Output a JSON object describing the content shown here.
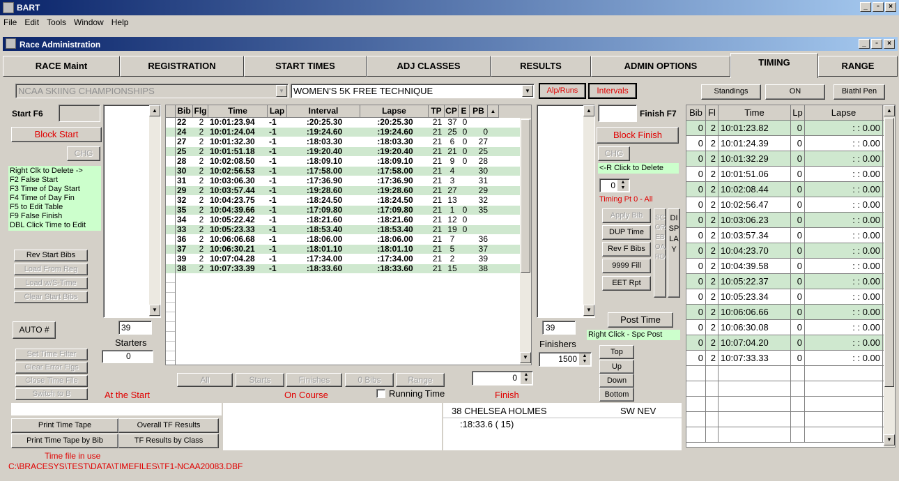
{
  "app": {
    "title": "BART",
    "child_title": "Race Administration"
  },
  "menu": [
    "File",
    "Edit",
    "Tools",
    "Window",
    "Help"
  ],
  "tabs": [
    "RACE Maint",
    "REGISTRATION",
    "START TIMES",
    "ADJ CLASSES",
    "RESULTS",
    "ADMIN OPTIONS",
    "TIMING",
    "RANGE"
  ],
  "active_tab": "TIMING",
  "event": {
    "championship": "NCAA SKIING CHAMPIONSHIPS",
    "race": "WOMEN'S 5K FREE TECHNIQUE"
  },
  "mode_buttons": {
    "alp_runs": "Alp/Runs",
    "intervals": "Intervals"
  },
  "top_right_buttons": {
    "standings": "Standings",
    "on": "ON",
    "biathl": "Biathl Pen"
  },
  "start": {
    "label": "Start F6",
    "block_start": "Block Start",
    "chg": "CHG",
    "help": [
      "Right Clk to Delete ->",
      "F2 False Start",
      "F3 Time of Day Start",
      "F4 Time of Day Fin",
      "F5 to Edit Table",
      "F9 False Finish",
      "DBL Click Time to Edit"
    ],
    "buttons": [
      "Rev Start Bibs",
      "Load From Reg",
      "Load w/S-Time",
      "Clear Start Bibs"
    ],
    "auto": "AUTO #",
    "starters_count": "39",
    "starters_label": "Starters",
    "filter_value": "0",
    "lower_buttons": [
      "Set Time Filter",
      "Clear Error Flgs",
      "Close Time File",
      "Switch to B"
    ],
    "status": "At the Start"
  },
  "main_table": {
    "headers": [
      "Bib",
      "Flg",
      "Time",
      "Lap",
      "Interval",
      "Lapse",
      "TP",
      "CP",
      "E",
      "PB"
    ],
    "rows": [
      [
        "22",
        "2",
        "10:01:23.94",
        "-1",
        ":20:25.30",
        ":20:25.30",
        "21",
        "37",
        "0",
        ""
      ],
      [
        "24",
        "2",
        "10:01:24.04",
        "-1",
        ":19:24.60",
        ":19:24.60",
        "21",
        "25",
        "0",
        "0"
      ],
      [
        "27",
        "2",
        "10:01:32.30",
        "-1",
        ":18:03.30",
        ":18:03.30",
        "21",
        "6",
        "0",
        "27"
      ],
      [
        "25",
        "2",
        "10:01:51.18",
        "-1",
        ":19:20.40",
        ":19:20.40",
        "21",
        "21",
        "0",
        "25"
      ],
      [
        "28",
        "2",
        "10:02:08.50",
        "-1",
        ":18:09.10",
        ":18:09.10",
        "21",
        "9",
        "0",
        "28"
      ],
      [
        "30",
        "2",
        "10:02:56.53",
        "-1",
        ":17:58.00",
        ":17:58.00",
        "21",
        "4",
        "",
        "30"
      ],
      [
        "31",
        "2",
        "10:03:06.30",
        "-1",
        ":17:36.90",
        ":17:36.90",
        "21",
        "3",
        "",
        "31"
      ],
      [
        "29",
        "2",
        "10:03:57.44",
        "-1",
        ":19:28.60",
        ":19:28.60",
        "21",
        "27",
        "",
        "29"
      ],
      [
        "32",
        "2",
        "10:04:23.75",
        "-1",
        ":18:24.50",
        ":18:24.50",
        "21",
        "13",
        "",
        "32"
      ],
      [
        "35",
        "2",
        "10:04:39.66",
        "-1",
        ":17:09.80",
        ":17:09.80",
        "21",
        "1",
        "0",
        "35"
      ],
      [
        "34",
        "2",
        "10:05:22.42",
        "-1",
        ":18:21.60",
        ":18:21.60",
        "21",
        "12",
        "0",
        ""
      ],
      [
        "33",
        "2",
        "10:05:23.33",
        "-1",
        ":18:53.40",
        ":18:53.40",
        "21",
        "19",
        "0",
        ""
      ],
      [
        "36",
        "2",
        "10:06:06.68",
        "-1",
        ":18:06.00",
        ":18:06.00",
        "21",
        "7",
        "",
        "36"
      ],
      [
        "37",
        "2",
        "10:06:30.21",
        "-1",
        ":18:01.10",
        ":18:01.10",
        "21",
        "5",
        "",
        "37"
      ],
      [
        "39",
        "2",
        "10:07:04.28",
        "-1",
        ":17:34.00",
        ":17:34.00",
        "21",
        "2",
        "",
        "39"
      ],
      [
        "38",
        "2",
        "10:07:33.39",
        "-1",
        ":18:33.60",
        ":18:33.60",
        "21",
        "15",
        "",
        "38"
      ]
    ]
  },
  "filter_buttons": [
    "All",
    "Starts",
    "Finishes",
    "0 Bibs",
    "Range"
  ],
  "spinner_value": "0",
  "on_course": "On Course",
  "running_time": "Running Time",
  "finish_status": "Finish",
  "finish": {
    "label": "Finish F7",
    "block_finish": "Block Finish",
    "chg": "CHG",
    "help_delete": "<-R Click to Delete",
    "timing_pt_value": "0",
    "timing_pt": "Timing Pt  0 - All",
    "buttons": [
      "Apply Bib",
      "DUP Time",
      "Rev F Bibs",
      "9999 Fill",
      "EET Rpt"
    ],
    "scoreboard": "SCOREBOARD",
    "display": "DISPLAY",
    "post_time": "Post Time",
    "right_click": "Right Click - Spc Post",
    "finishers_count": "39",
    "finishers_label": "Finishers",
    "finishers_spin": "1500",
    "nav": [
      "Top",
      "Up",
      "Down",
      "Bottom"
    ]
  },
  "bottom": {
    "buttons": [
      "Print Time Tape",
      "Overall TF Results",
      "Print Time Tape by Bib",
      "TF Results by Class"
    ],
    "racer_name": "38 CHELSEA HOLMES",
    "racer_info": "SW  NEV",
    "racer_time": ":18:33.6   ( 15)",
    "file_label": "Time file in use",
    "file_path": "C:\\BRACESYS\\TEST\\DATA\\TIMEFILES\\TF1-NCAA20083.DBF"
  },
  "timing_table": {
    "headers": [
      "Bib",
      "Fl",
      "Time",
      "Lp",
      "Lapse"
    ],
    "rows": [
      [
        "0",
        "2",
        "10:01:23.82",
        "0",
        ":  : 0.00"
      ],
      [
        "0",
        "2",
        "10:01:24.39",
        "0",
        ":  : 0.00"
      ],
      [
        "0",
        "2",
        "10:01:32.29",
        "0",
        ":  : 0.00"
      ],
      [
        "0",
        "2",
        "10:01:51.06",
        "0",
        ":  : 0.00"
      ],
      [
        "0",
        "2",
        "10:02:08.44",
        "0",
        ":  : 0.00"
      ],
      [
        "0",
        "2",
        "10:02:56.47",
        "0",
        ":  : 0.00"
      ],
      [
        "0",
        "2",
        "10:03:06.23",
        "0",
        ":  : 0.00"
      ],
      [
        "0",
        "2",
        "10:03:57.34",
        "0",
        ":  : 0.00"
      ],
      [
        "0",
        "2",
        "10:04:23.70",
        "0",
        ":  : 0.00"
      ],
      [
        "0",
        "2",
        "10:04:39.58",
        "0",
        ":  : 0.00"
      ],
      [
        "0",
        "2",
        "10:05:22.37",
        "0",
        ":  : 0.00"
      ],
      [
        "0",
        "2",
        "10:05:23.34",
        "0",
        ":  : 0.00"
      ],
      [
        "0",
        "2",
        "10:06:06.66",
        "0",
        ":  : 0.00"
      ],
      [
        "0",
        "2",
        "10:06:30.08",
        "0",
        ":  : 0.00"
      ],
      [
        "0",
        "2",
        "10:07:04.20",
        "0",
        ":  : 0.00"
      ],
      [
        "0",
        "2",
        "10:07:33.33",
        "0",
        ":  : 0.00"
      ]
    ]
  }
}
